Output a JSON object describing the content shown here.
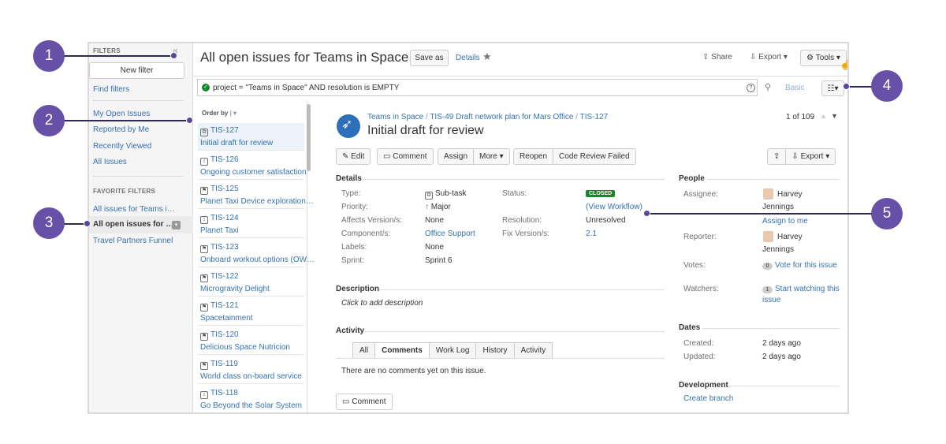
{
  "sidebar": {
    "filters_heading": "FILTERS",
    "collapse_glyph": "«",
    "new_filter": "New filter",
    "find_filters": "Find filters",
    "items": [
      "My Open Issues",
      "Reported by Me",
      "Recently Viewed",
      "All Issues"
    ],
    "favorite_heading": "FAVORITE FILTERS",
    "favorites": [
      "All issues for Teams i…",
      "All open issues for …",
      "Travel Partners Funnel"
    ]
  },
  "header": {
    "title": "All open issues for Teams in Space",
    "save_as": "Save as",
    "details": "Details",
    "share": "Share",
    "export": "Export",
    "tools": "Tools"
  },
  "search": {
    "jql": "project = \"Teams in Space\" AND resolution is EMPTY",
    "help": "?",
    "basic": "Basic"
  },
  "list": {
    "order_by": "Order by",
    "items": [
      {
        "key": "TIS-127",
        "summary": "Initial draft for review",
        "type": "subtask"
      },
      {
        "key": "TIS-126",
        "summary": "Ongoing customer satisfaction",
        "type": "improvement"
      },
      {
        "key": "TIS-125",
        "summary": "Planet Taxi Device exploration…",
        "type": "story"
      },
      {
        "key": "TIS-124",
        "summary": "Planet Taxi",
        "type": "improvement"
      },
      {
        "key": "TIS-123",
        "summary": "Onboard workout options (OW…",
        "type": "story"
      },
      {
        "key": "TIS-122",
        "summary": "Microgravity Delight",
        "type": "story"
      },
      {
        "key": "TIS-121",
        "summary": "Spacetainment",
        "type": "story"
      },
      {
        "key": "TIS-120",
        "summary": "Delicious Space Nutricion",
        "type": "story"
      },
      {
        "key": "TIS-119",
        "summary": "World class on-board service",
        "type": "story"
      },
      {
        "key": "TIS-118",
        "summary": "Go Beyond the Solar System",
        "type": "improvement"
      }
    ]
  },
  "issue": {
    "breadcrumb": [
      "Teams in Space",
      "TIS-49 Draft network plan for Mars Office",
      "TIS-127"
    ],
    "breadcrumb_sep": "/",
    "title": "Initial draft for review",
    "pager": "1 of 109",
    "actions": {
      "edit": "Edit",
      "comment": "Comment",
      "assign": "Assign",
      "more": "More",
      "reopen": "Reopen",
      "code_review_failed": "Code Review Failed",
      "export": "Export"
    },
    "details_heading": "Details",
    "fields": {
      "type_label": "Type:",
      "type": "Sub-task",
      "priority_label": "Priority:",
      "priority": "Major",
      "affects_label": "Affects Version/s:",
      "affects": "None",
      "components_label": "Component/s:",
      "components": "Office Support",
      "labels_label": "Labels:",
      "labels": "None",
      "sprint_label": "Sprint:",
      "sprint": "Sprint 6",
      "status_label": "Status:",
      "status": "CLOSED",
      "workflow": "(View Workflow)",
      "resolution_label": "Resolution:",
      "resolution": "Unresolved",
      "fix_label": "Fix Version/s:",
      "fix": "2.1"
    },
    "description_heading": "Description",
    "description_placeholder": "Click to add description",
    "activity_heading": "Activity",
    "activity_tabs": [
      "All",
      "Comments",
      "Work Log",
      "History",
      "Activity"
    ],
    "no_comments": "There are no comments yet on this issue.",
    "comment_button": "Comment",
    "people": {
      "heading": "People",
      "assignee_label": "Assignee:",
      "assignee_first": "Harvey",
      "assignee_last": "Jennings",
      "assign_to_me": "Assign to me",
      "reporter_label": "Reporter:",
      "reporter_first": "Harvey",
      "reporter_last": "Jennings",
      "votes_label": "Votes:",
      "votes_count": "0",
      "vote_link": "Vote for this issue",
      "watchers_label": "Watchers:",
      "watchers_count": "1",
      "watch_link_1": "Start watching this",
      "watch_link_2": "issue"
    },
    "dates": {
      "heading": "Dates",
      "created_label": "Created:",
      "created": "2 days ago",
      "updated_label": "Updated:",
      "updated": "2 days ago"
    },
    "development": {
      "heading": "Development",
      "create_branch": "Create branch"
    }
  },
  "callouts": [
    "1",
    "2",
    "3",
    "4",
    "5"
  ],
  "colors": {
    "link": "#3572b0",
    "callout": "#6650a8",
    "closed": "#14892c",
    "priority": "#d04437"
  }
}
